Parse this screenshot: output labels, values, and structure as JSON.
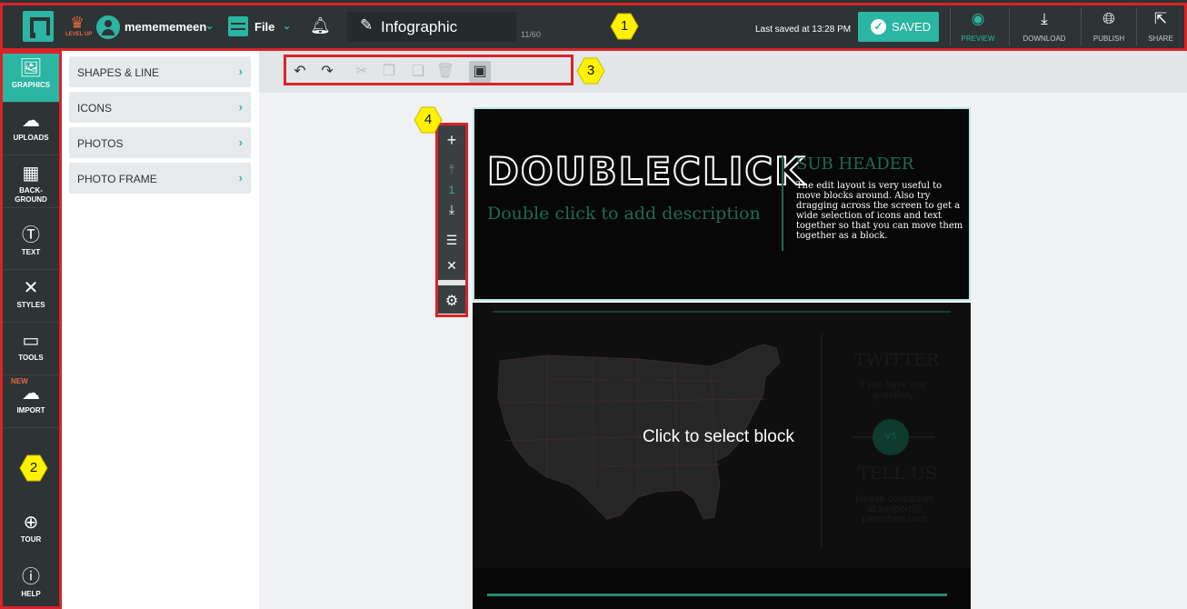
{
  "topbar": {
    "level_up": "LEVEL UP",
    "username": "memememeen",
    "file_label": "File",
    "title": "Infographic",
    "title_count": "11/60",
    "last_saved": "Last saved at 13:28 PM",
    "saved_label": "SAVED",
    "tools": [
      {
        "label": "PREVIEW",
        "icon": "eye-icon"
      },
      {
        "label": "DOWNLOAD",
        "icon": "download-icon"
      },
      {
        "label": "PUBLISH",
        "icon": "globe-icon"
      },
      {
        "label": "SHARE",
        "icon": "share-icon"
      }
    ]
  },
  "leftnav": {
    "items": [
      {
        "label": "GRAPHICS",
        "icon": "image-icon"
      },
      {
        "label": "UPLOADS",
        "icon": "cloud-upload-icon"
      },
      {
        "label": "BACK-GROUND",
        "icon": "background-icon"
      },
      {
        "label": "TEXT",
        "icon": "text-icon"
      },
      {
        "label": "STYLES",
        "icon": "styles-icon"
      },
      {
        "label": "TOOLS",
        "icon": "toolbox-icon"
      },
      {
        "label": "IMPORT",
        "icon": "cloud-import-icon",
        "badge": "NEW"
      }
    ],
    "tour_label": "TOUR",
    "help_label": "HELP"
  },
  "sidepanel": {
    "items": [
      "SHAPES & LINE",
      "ICONS",
      "PHOTOS",
      "PHOTO FRAME"
    ]
  },
  "edit_toolbar": {
    "icons": [
      "undo-icon",
      "redo-icon",
      "cut-icon",
      "copy-icon",
      "paste-icon",
      "delete-icon",
      "arrange-icon"
    ]
  },
  "canvas": {
    "block1": {
      "title": "DOUBLECLICK",
      "description": "Double click to add description",
      "subheader": "SUB HEADER",
      "subtext": "The edit layout is very useful to move blocks around. Also try dragging across the screen to get a wide selection of icons and text together so that you can move them together as a block."
    },
    "block2": {
      "click_to_select": "Click to select block",
      "twitter": "TWITTER",
      "twitter_sub": "If you have any question,",
      "vs": "VS",
      "tell_us": "TELL US",
      "tell_us_sub": "please contact us at support@ piktochart.com"
    },
    "block_tools": {
      "block_number": "1",
      "icons": [
        "plus-icon",
        "move-up-icon",
        "move-down-icon",
        "duplicate-icon",
        "close-icon",
        "settings-icon"
      ]
    }
  },
  "annotations": [
    "1",
    "2",
    "3",
    "4"
  ],
  "colors": {
    "accent": "#2bb5a3",
    "topbar": "#2e3335",
    "annotation_red": "#d8232a",
    "callout_yellow": "#fff200"
  }
}
